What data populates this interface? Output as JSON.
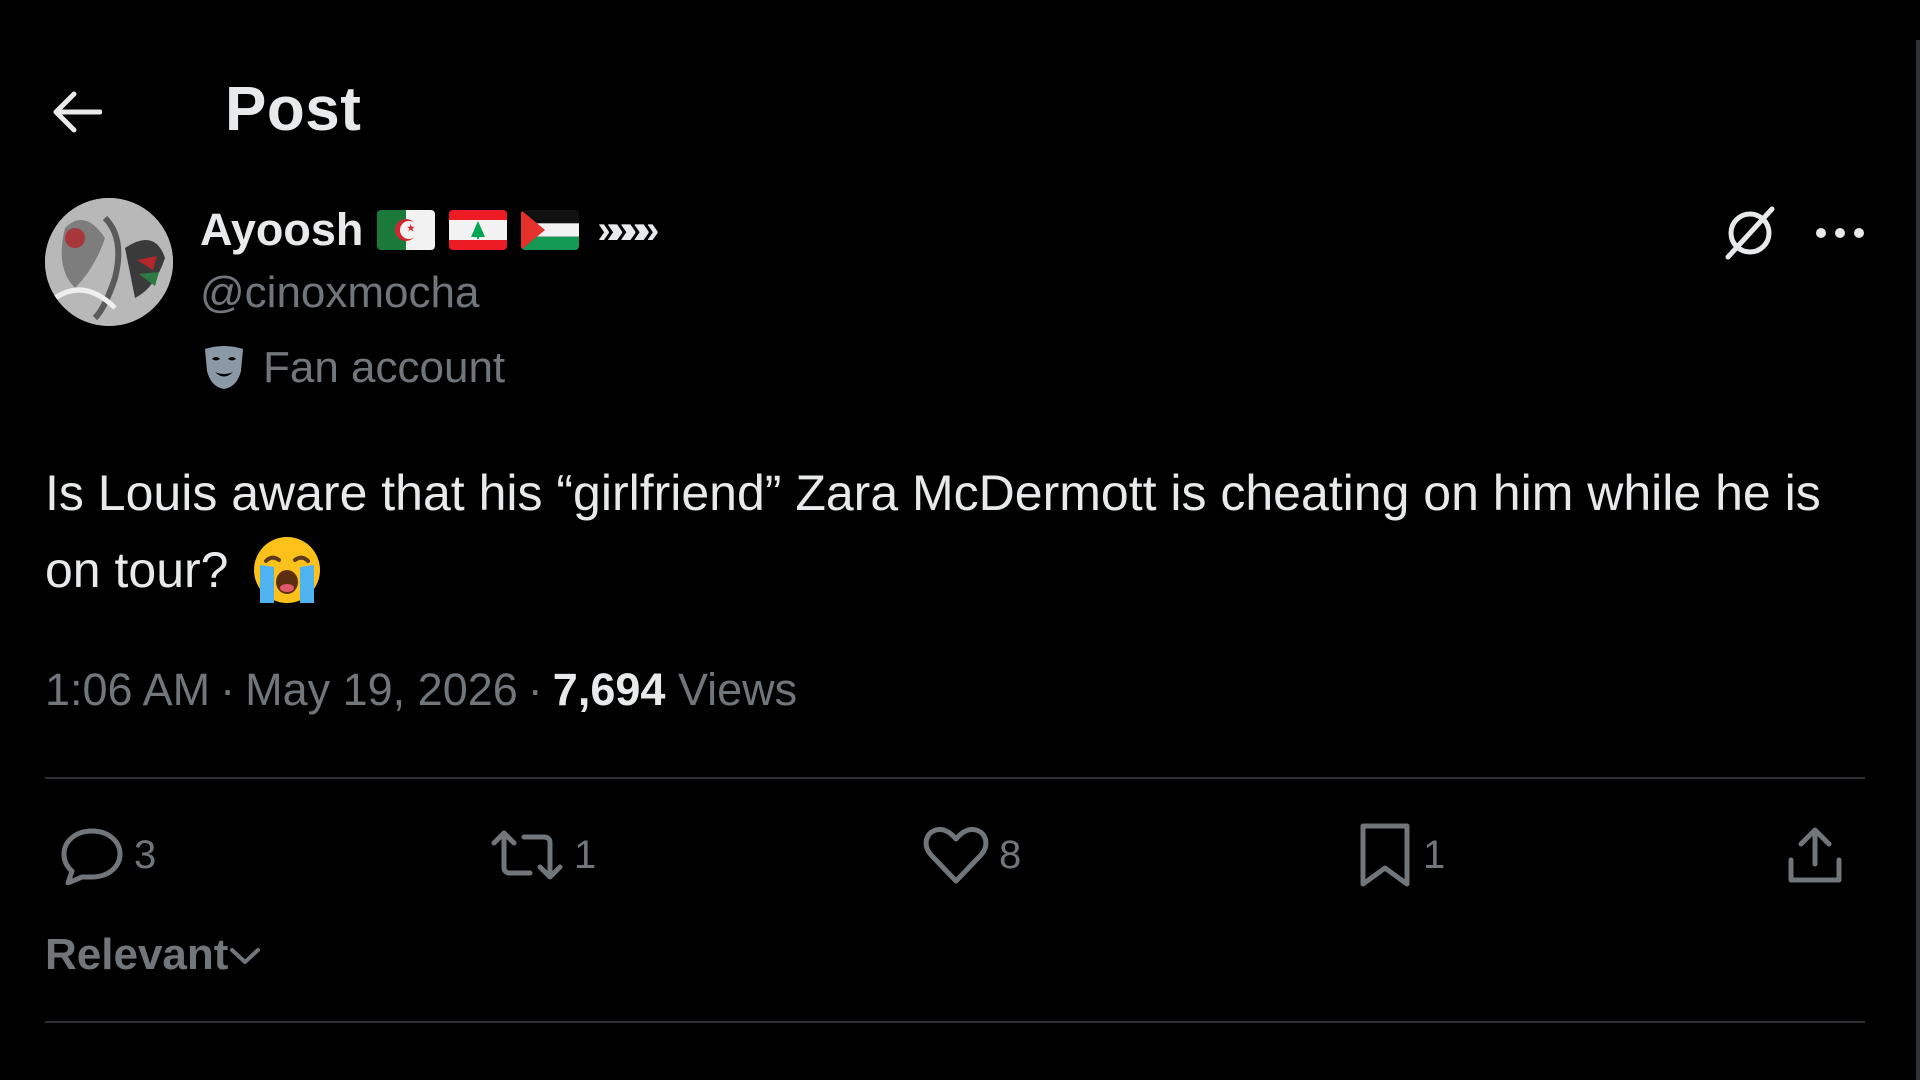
{
  "header": {
    "title": "Post",
    "back_icon": "arrow-left-icon"
  },
  "author": {
    "display_name": "Ayoosh",
    "flags": [
      "algeria-flag",
      "lebanon-flag",
      "palestine-flag"
    ],
    "name_suffix": "»»»»",
    "handle": "@cinoxmocha",
    "label": "Fan account",
    "label_icon": "theater-mask-icon"
  },
  "post": {
    "text": "Is Louis aware that his “girlfriend” Zara McDermott is cheating on him while he is on tour?",
    "emoji": "loudly-crying-face"
  },
  "meta": {
    "time": "1:06 AM",
    "date": "May 19, 2026",
    "views_count": "7,694",
    "views_label": "Views",
    "separator": "·"
  },
  "actions": {
    "replies": "3",
    "reposts": "1",
    "likes": "8",
    "bookmarks": "1"
  },
  "sort": {
    "label": "Relevant"
  },
  "colors": {
    "background": "#000000",
    "primary_text": "#e7e9ea",
    "secondary_text": "#71767b",
    "divider": "#2f3336"
  }
}
